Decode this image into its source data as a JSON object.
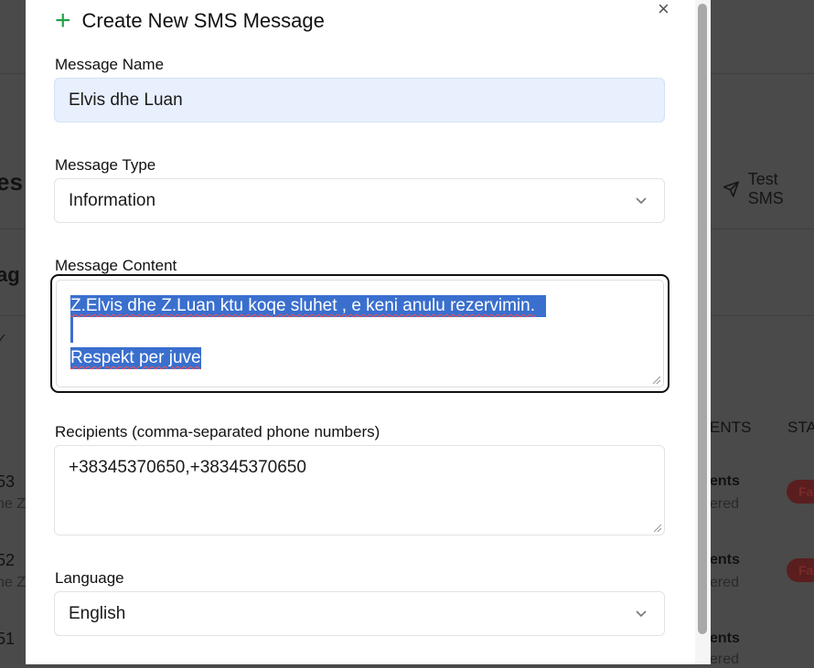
{
  "background": {
    "heading_fragment": "es",
    "subheading_fragment": "ag",
    "check_glyph": "✓",
    "test_sms_label": "Test SMS",
    "column_headers": [
      "ENTS",
      "STA"
    ],
    "rows": [
      {
        "id_fragment": "53",
        "name_fragment": "he Z",
        "col1": "ents",
        "col1_sub": "ered",
        "status": "Fa"
      },
      {
        "id_fragment": "52",
        "name_fragment": "he Z",
        "col1": "ents",
        "col1_sub": "ered",
        "status": "Fa"
      },
      {
        "id_fragment": "51",
        "name_fragment": "",
        "col1": "ents",
        "col1_sub": "ered",
        "status": ""
      }
    ]
  },
  "modal": {
    "title": "Create New SMS Message",
    "close_glyph": "×",
    "message_name_label": "Message Name",
    "message_name_value": "Elvis dhe Luan",
    "message_type_label": "Message Type",
    "message_type_value": "Information",
    "message_content_label": "Message Content",
    "message_content_lines": [
      "Z.Elvis dhe Z.Luan ktu koqe sluhet , e keni anulu rezervimin.",
      "",
      "Respekt per juve"
    ],
    "recipients_label": "Recipients (comma-separated phone numbers)",
    "recipients_value": "+38345370650,+38345370650",
    "language_label": "Language",
    "language_value": "English"
  },
  "colors": {
    "accent_green": "#22a045",
    "selection_blue": "#3a6fce",
    "filled_input": "#e8effd"
  }
}
